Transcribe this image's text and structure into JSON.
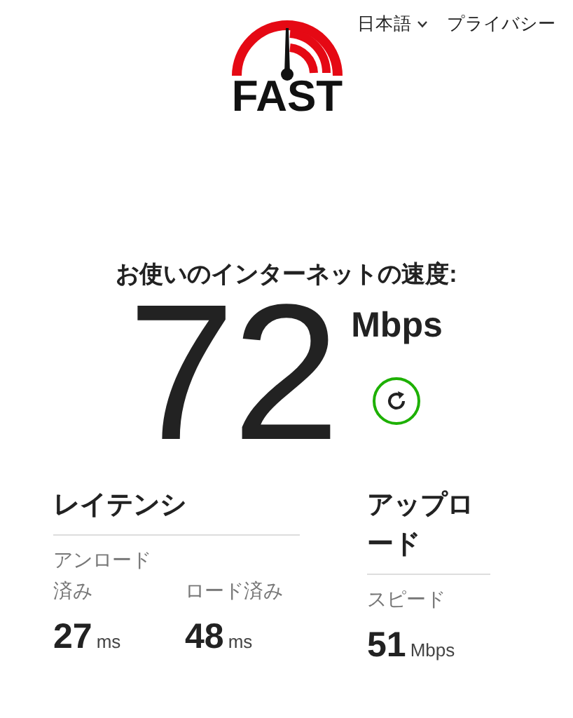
{
  "header": {
    "logo_text": "FAST",
    "nav": [
      {
        "kind": "dropdown",
        "label": "日本語"
      },
      {
        "kind": "link",
        "label": "プライバシー"
      }
    ]
  },
  "speed": {
    "title": "お使いのインターネットの速度:",
    "value": "72",
    "unit": "Mbps"
  },
  "metrics": [
    {
      "title": "レイテンシ",
      "items": [
        {
          "label": "アンロード済み",
          "value": "27",
          "unit": "ms"
        },
        {
          "label": "ロード済み",
          "value": "48",
          "unit": "ms"
        }
      ]
    },
    {
      "title": "アップロード",
      "items": [
        {
          "label": "スピード",
          "value": "51",
          "unit": "Mbps"
        }
      ]
    }
  ]
}
